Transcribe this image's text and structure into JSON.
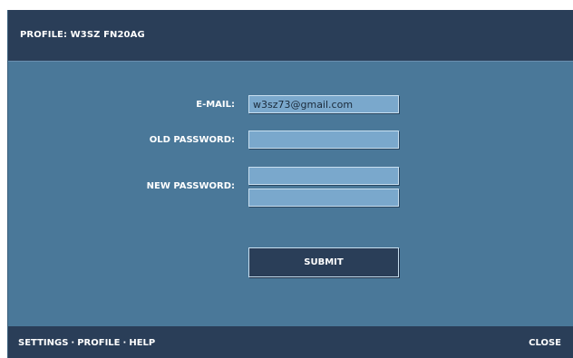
{
  "header": {
    "title": "PROFILE: W3SZ FN20AG"
  },
  "form": {
    "email_label": "E-MAIL:",
    "email_value": "w3sz73@gmail.com",
    "old_password_label": "OLD PASSWORD:",
    "old_password_value": "",
    "new_password_label": "NEW PASSWORD:",
    "new_password_value": "",
    "confirm_password_value": "",
    "submit_label": "SUBMIT"
  },
  "footer": {
    "nav": [
      {
        "label": "SETTINGS"
      },
      {
        "label": "PROFILE"
      },
      {
        "label": "HELP"
      }
    ],
    "separator": "·",
    "close_label": "CLOSE"
  }
}
